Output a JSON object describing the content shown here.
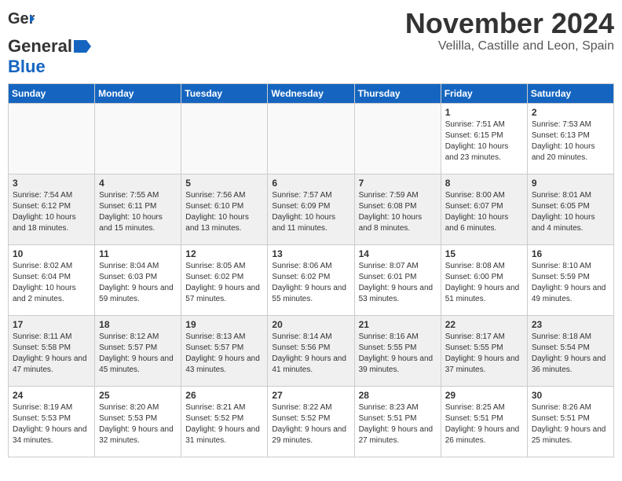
{
  "logo": {
    "general": "General",
    "blue": "Blue"
  },
  "header": {
    "month": "November 2024",
    "location": "Velilla, Castille and Leon, Spain"
  },
  "days_of_week": [
    "Sunday",
    "Monday",
    "Tuesday",
    "Wednesday",
    "Thursday",
    "Friday",
    "Saturday"
  ],
  "weeks": [
    {
      "shaded": false,
      "days": [
        {
          "num": "",
          "info": ""
        },
        {
          "num": "",
          "info": ""
        },
        {
          "num": "",
          "info": ""
        },
        {
          "num": "",
          "info": ""
        },
        {
          "num": "",
          "info": ""
        },
        {
          "num": "1",
          "info": "Sunrise: 7:51 AM\nSunset: 6:15 PM\nDaylight: 10 hours and 23 minutes."
        },
        {
          "num": "2",
          "info": "Sunrise: 7:53 AM\nSunset: 6:13 PM\nDaylight: 10 hours and 20 minutes."
        }
      ]
    },
    {
      "shaded": true,
      "days": [
        {
          "num": "3",
          "info": "Sunrise: 7:54 AM\nSunset: 6:12 PM\nDaylight: 10 hours and 18 minutes."
        },
        {
          "num": "4",
          "info": "Sunrise: 7:55 AM\nSunset: 6:11 PM\nDaylight: 10 hours and 15 minutes."
        },
        {
          "num": "5",
          "info": "Sunrise: 7:56 AM\nSunset: 6:10 PM\nDaylight: 10 hours and 13 minutes."
        },
        {
          "num": "6",
          "info": "Sunrise: 7:57 AM\nSunset: 6:09 PM\nDaylight: 10 hours and 11 minutes."
        },
        {
          "num": "7",
          "info": "Sunrise: 7:59 AM\nSunset: 6:08 PM\nDaylight: 10 hours and 8 minutes."
        },
        {
          "num": "8",
          "info": "Sunrise: 8:00 AM\nSunset: 6:07 PM\nDaylight: 10 hours and 6 minutes."
        },
        {
          "num": "9",
          "info": "Sunrise: 8:01 AM\nSunset: 6:05 PM\nDaylight: 10 hours and 4 minutes."
        }
      ]
    },
    {
      "shaded": false,
      "days": [
        {
          "num": "10",
          "info": "Sunrise: 8:02 AM\nSunset: 6:04 PM\nDaylight: 10 hours and 2 minutes."
        },
        {
          "num": "11",
          "info": "Sunrise: 8:04 AM\nSunset: 6:03 PM\nDaylight: 9 hours and 59 minutes."
        },
        {
          "num": "12",
          "info": "Sunrise: 8:05 AM\nSunset: 6:02 PM\nDaylight: 9 hours and 57 minutes."
        },
        {
          "num": "13",
          "info": "Sunrise: 8:06 AM\nSunset: 6:02 PM\nDaylight: 9 hours and 55 minutes."
        },
        {
          "num": "14",
          "info": "Sunrise: 8:07 AM\nSunset: 6:01 PM\nDaylight: 9 hours and 53 minutes."
        },
        {
          "num": "15",
          "info": "Sunrise: 8:08 AM\nSunset: 6:00 PM\nDaylight: 9 hours and 51 minutes."
        },
        {
          "num": "16",
          "info": "Sunrise: 8:10 AM\nSunset: 5:59 PM\nDaylight: 9 hours and 49 minutes."
        }
      ]
    },
    {
      "shaded": true,
      "days": [
        {
          "num": "17",
          "info": "Sunrise: 8:11 AM\nSunset: 5:58 PM\nDaylight: 9 hours and 47 minutes."
        },
        {
          "num": "18",
          "info": "Sunrise: 8:12 AM\nSunset: 5:57 PM\nDaylight: 9 hours and 45 minutes."
        },
        {
          "num": "19",
          "info": "Sunrise: 8:13 AM\nSunset: 5:57 PM\nDaylight: 9 hours and 43 minutes."
        },
        {
          "num": "20",
          "info": "Sunrise: 8:14 AM\nSunset: 5:56 PM\nDaylight: 9 hours and 41 minutes."
        },
        {
          "num": "21",
          "info": "Sunrise: 8:16 AM\nSunset: 5:55 PM\nDaylight: 9 hours and 39 minutes."
        },
        {
          "num": "22",
          "info": "Sunrise: 8:17 AM\nSunset: 5:55 PM\nDaylight: 9 hours and 37 minutes."
        },
        {
          "num": "23",
          "info": "Sunrise: 8:18 AM\nSunset: 5:54 PM\nDaylight: 9 hours and 36 minutes."
        }
      ]
    },
    {
      "shaded": false,
      "days": [
        {
          "num": "24",
          "info": "Sunrise: 8:19 AM\nSunset: 5:53 PM\nDaylight: 9 hours and 34 minutes."
        },
        {
          "num": "25",
          "info": "Sunrise: 8:20 AM\nSunset: 5:53 PM\nDaylight: 9 hours and 32 minutes."
        },
        {
          "num": "26",
          "info": "Sunrise: 8:21 AM\nSunset: 5:52 PM\nDaylight: 9 hours and 31 minutes."
        },
        {
          "num": "27",
          "info": "Sunrise: 8:22 AM\nSunset: 5:52 PM\nDaylight: 9 hours and 29 minutes."
        },
        {
          "num": "28",
          "info": "Sunrise: 8:23 AM\nSunset: 5:51 PM\nDaylight: 9 hours and 27 minutes."
        },
        {
          "num": "29",
          "info": "Sunrise: 8:25 AM\nSunset: 5:51 PM\nDaylight: 9 hours and 26 minutes."
        },
        {
          "num": "30",
          "info": "Sunrise: 8:26 AM\nSunset: 5:51 PM\nDaylight: 9 hours and 25 minutes."
        }
      ]
    }
  ]
}
